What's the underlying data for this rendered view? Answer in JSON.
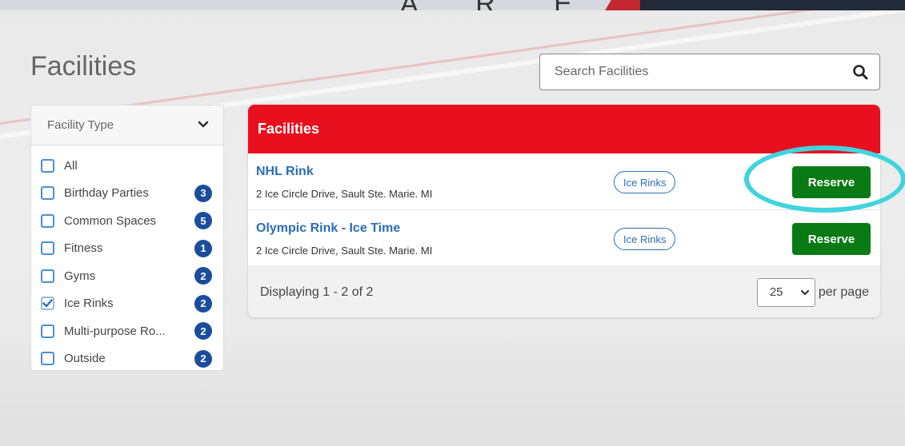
{
  "banner": {
    "brand_text": "A R E N A"
  },
  "page": {
    "title": "Facilities"
  },
  "search": {
    "placeholder": "Search Facilities",
    "icon": "search-icon"
  },
  "filter": {
    "header": "Facility Type",
    "items": [
      {
        "label": "All",
        "count": "",
        "checked": false
      },
      {
        "label": "Birthday Parties",
        "count": "3",
        "checked": false
      },
      {
        "label": "Common Spaces",
        "count": "5",
        "checked": false
      },
      {
        "label": "Fitness",
        "count": "1",
        "checked": false
      },
      {
        "label": "Gyms",
        "count": "2",
        "checked": false
      },
      {
        "label": "Ice Rinks",
        "count": "2",
        "checked": true
      },
      {
        "label": "Multi-purpose Ro...",
        "count": "2",
        "checked": false
      },
      {
        "label": "Outside",
        "count": "2",
        "checked": false
      }
    ]
  },
  "results": {
    "header": "Facilities",
    "rows": [
      {
        "name": "NHL Rink",
        "address": "2 Ice Circle Drive, Sault Ste. Marie. MI",
        "tag": "Ice Rinks",
        "action": "Reserve"
      },
      {
        "name": "Olympic Rink - Ice Time",
        "address": "2 Ice Circle Drive, Sault Ste. Marie. MI",
        "tag": "Ice Rinks",
        "action": "Reserve"
      }
    ],
    "footer": {
      "displaying": "Displaying 1 - 2 of 2",
      "per_page_value": "25",
      "per_page_label": "per page"
    }
  },
  "colors": {
    "header_red": "#e8101f",
    "reserve_green": "#0a7a14",
    "count_blue": "#1a4d9c",
    "highlight": "#3fd4de"
  }
}
